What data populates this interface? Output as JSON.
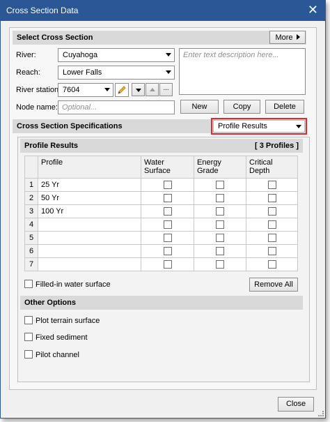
{
  "window": {
    "title": "Cross Section Data",
    "close_glyph": "✕"
  },
  "select_section": {
    "header": "Select Cross Section",
    "more_label": "More",
    "river_label": "River:",
    "river_value": "Cuyahoga",
    "reach_label": "Reach:",
    "reach_value": "Lower Falls",
    "station_label": "River station:",
    "station_value": "7604",
    "node_label": "Node name:",
    "node_placeholder": "Optional...",
    "description_placeholder": "Enter text description here...",
    "ellipsis": "...",
    "new_label": "New",
    "copy_label": "Copy",
    "delete_label": "Delete"
  },
  "specs": {
    "header": "Cross Section Specifications",
    "dropdown_value": "Profile Results",
    "accent_color": "#e0282e"
  },
  "profile_results": {
    "header": "Profile Results",
    "count_label": "[ 3 Profiles ]",
    "columns": [
      {
        "line1": "Profile",
        "line2": ""
      },
      {
        "line1": "Water",
        "line2": "Surface"
      },
      {
        "line1": "Energy",
        "line2": "Grade"
      },
      {
        "line1": "Critical",
        "line2": "Depth"
      }
    ],
    "rows": [
      {
        "num": "1",
        "name": "25 Yr"
      },
      {
        "num": "2",
        "name": "50 Yr"
      },
      {
        "num": "3",
        "name": "100 Yr"
      },
      {
        "num": "4",
        "name": ""
      },
      {
        "num": "5",
        "name": ""
      },
      {
        "num": "6",
        "name": ""
      },
      {
        "num": "7",
        "name": ""
      }
    ],
    "filled_label": "Filled-in water surface",
    "remove_all_label": "Remove All"
  },
  "other_options": {
    "header": "Other Options",
    "plot_terrain": "Plot terrain surface",
    "fixed_sediment": "Fixed sediment",
    "pilot_channel": "Pilot channel"
  },
  "footer": {
    "close_label": "Close"
  }
}
